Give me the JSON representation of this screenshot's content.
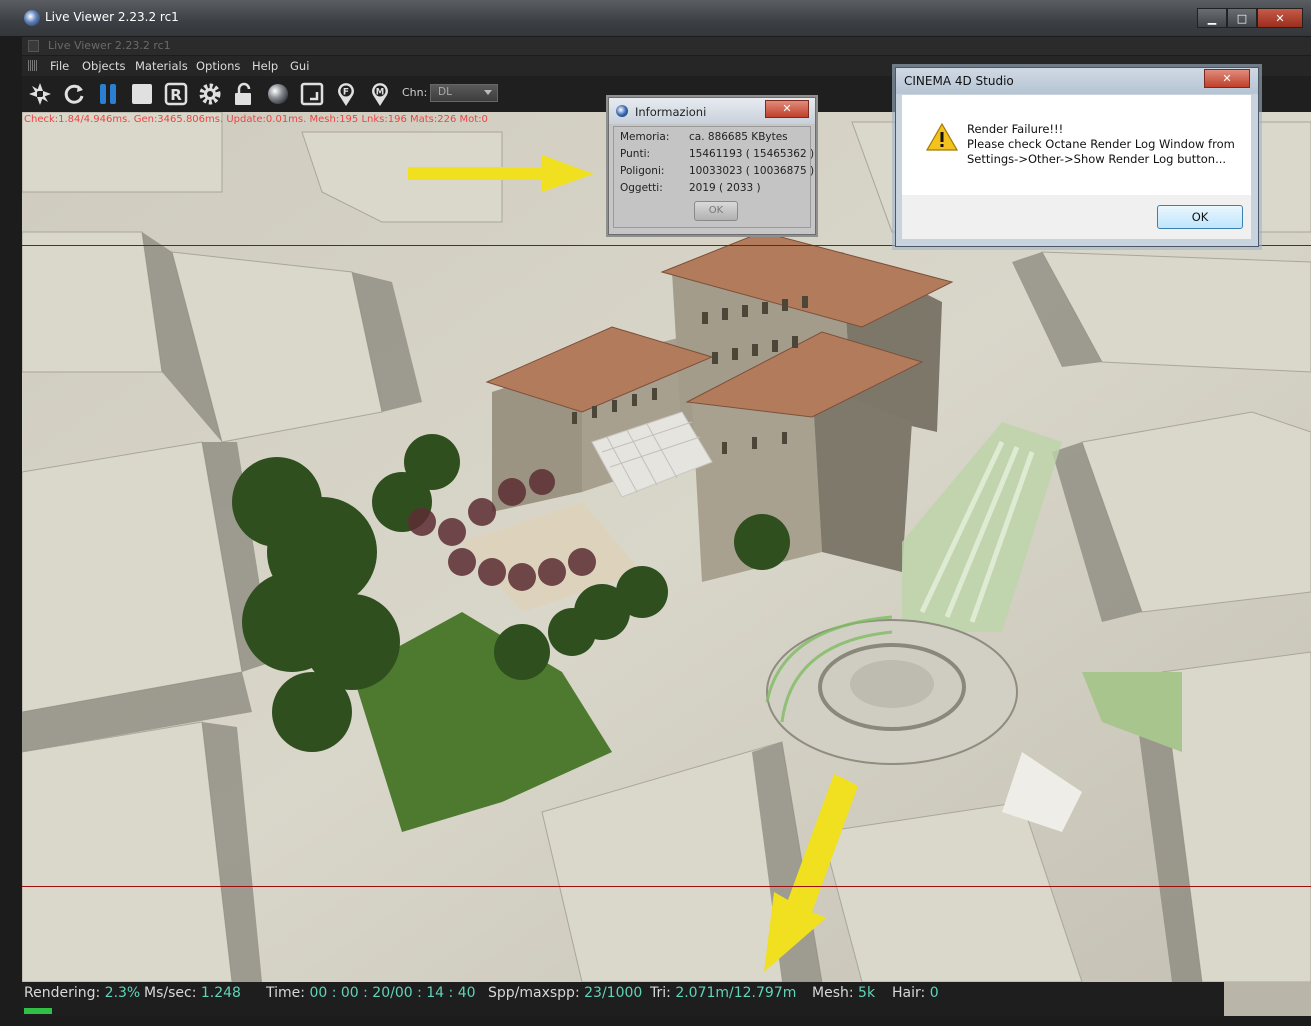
{
  "window": {
    "title": "Live Viewer 2.23.2 rc1",
    "inner_title": "Live Viewer 2.23.2 rc1",
    "minimize": "▁",
    "maximize": "□",
    "close": "✕"
  },
  "menu": [
    "File",
    "Objects",
    "Materials",
    "Options",
    "Help",
    "Gui"
  ],
  "toolbar": {
    "channel_label": "Chn:",
    "channel_value": "DL"
  },
  "debug_text": "Check:1.84/4.946ms. Gen:3465.806ms. Update:0.01ms. Mesh:195 Lnks:196 Mats:226 Mot:0",
  "info_dialog": {
    "title": "Informazioni",
    "close": "✕",
    "rows": [
      {
        "label": "Memoria:",
        "value": "ca. 886685 KBytes"
      },
      {
        "label": "Punti:",
        "value": "15461193 ( 15465362 )"
      },
      {
        "label": "Poligoni:",
        "value": "10033023 ( 10036875 )"
      },
      {
        "label": "Oggetti:",
        "value": "2019 ( 2033 )"
      }
    ],
    "ok": "OK"
  },
  "c4d_dialog": {
    "title": "CINEMA 4D Studio",
    "close": "✕",
    "line1": "Render Failure!!!",
    "line2": "Please check Octane Render Log Window from",
    "line3": "Settings->Other->Show Render Log button...",
    "ok": "OK"
  },
  "status": {
    "rendering_label": "Rendering:",
    "rendering_value": "2.3%",
    "ms_label": "Ms/sec:",
    "ms_value": "1.248",
    "time_label": "Time:",
    "time_value": "00 : 00 : 20/00 : 14 : 40",
    "spp_label": "Spp/maxspp:",
    "spp_value": "23/1000",
    "tri_label": "Tri:",
    "tri_value": "2.071m/12.797m",
    "mesh_label": "Mesh:",
    "mesh_value": "5k",
    "hair_label": "Hair:",
    "hair_value": "0",
    "progress": 0.023
  }
}
